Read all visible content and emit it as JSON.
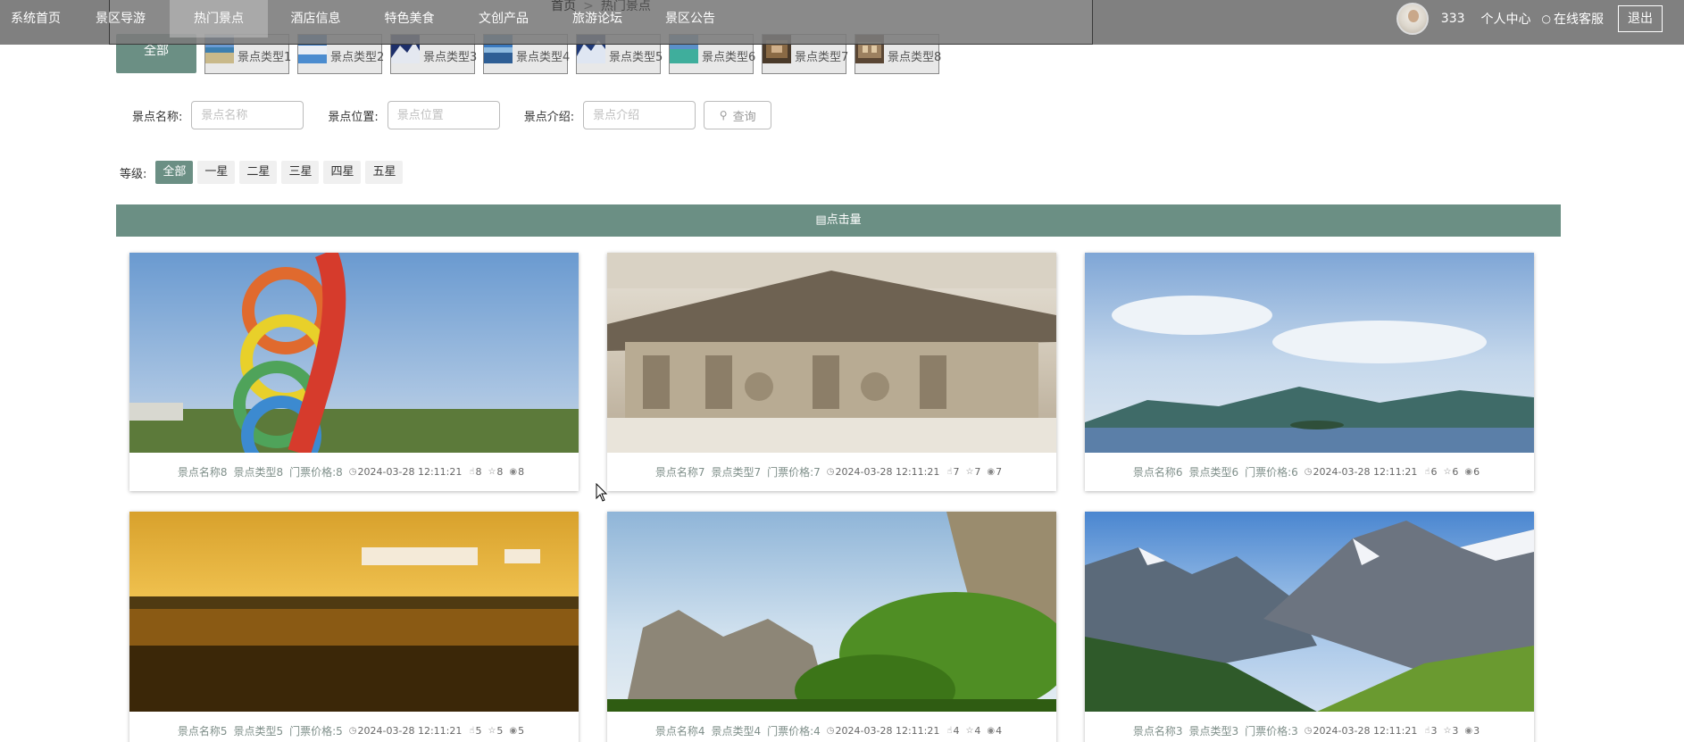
{
  "nav": {
    "items": [
      {
        "label": "系统首页",
        "active": false
      },
      {
        "label": "景区导游",
        "active": false
      },
      {
        "label": "热门景点",
        "active": true
      },
      {
        "label": "酒店信息",
        "active": false
      },
      {
        "label": "特色美食",
        "active": false
      },
      {
        "label": "文创产品",
        "active": false
      },
      {
        "label": "旅游论坛",
        "active": false
      },
      {
        "label": "景区公告",
        "active": false
      }
    ],
    "breadcrumb": {
      "home": "首页",
      "sep": ">",
      "current": "热门景点"
    },
    "user": {
      "name": "333",
      "center_label": "个人中心",
      "service_label": "在线客服",
      "logout_label": "退出"
    }
  },
  "types": {
    "all_label": "全部",
    "items": [
      "景点类型1",
      "景点类型2",
      "景点类型3",
      "景点类型4",
      "景点类型5",
      "景点类型6",
      "景点类型7",
      "景点类型8"
    ]
  },
  "search": {
    "name_label": "景点名称:",
    "name_placeholder": "景点名称",
    "location_label": "景点位置:",
    "location_placeholder": "景点位置",
    "intro_label": "景点介绍:",
    "intro_placeholder": "景点介绍",
    "button_label": "查询"
  },
  "levels": {
    "label": "等级:",
    "options": [
      "全部",
      "一星",
      "二星",
      "三星",
      "四星",
      "五星"
    ],
    "selected": "全部"
  },
  "sort_label": "点击量",
  "cards": [
    {
      "name": "景点名称8",
      "type": "景点类型8",
      "price": "门票价格:8",
      "date": "2024-03-28 12:11:21",
      "likes": "8",
      "favs": "8",
      "views": "8"
    },
    {
      "name": "景点名称7",
      "type": "景点类型7",
      "price": "门票价格:7",
      "date": "2024-03-28 12:11:21",
      "likes": "7",
      "favs": "7",
      "views": "7"
    },
    {
      "name": "景点名称6",
      "type": "景点类型6",
      "price": "门票价格:6",
      "date": "2024-03-28 12:11:21",
      "likes": "6",
      "favs": "6",
      "views": "6"
    },
    {
      "name": "景点名称5",
      "type": "景点类型5",
      "price": "门票价格:5",
      "date": "2024-03-28 12:11:21",
      "likes": "5",
      "favs": "5",
      "views": "5"
    },
    {
      "name": "景点名称4",
      "type": "景点类型4",
      "price": "门票价格:4",
      "date": "2024-03-28 12:11:21",
      "likes": "4",
      "favs": "4",
      "views": "4"
    },
    {
      "name": "景点名称3",
      "type": "景点类型3",
      "price": "门票价格:3",
      "date": "2024-03-28 12:11:21",
      "likes": "3",
      "favs": "3",
      "views": "3"
    }
  ],
  "colors": {
    "accent": "#6b8f84",
    "nav_bg": "#6e6e6e"
  }
}
